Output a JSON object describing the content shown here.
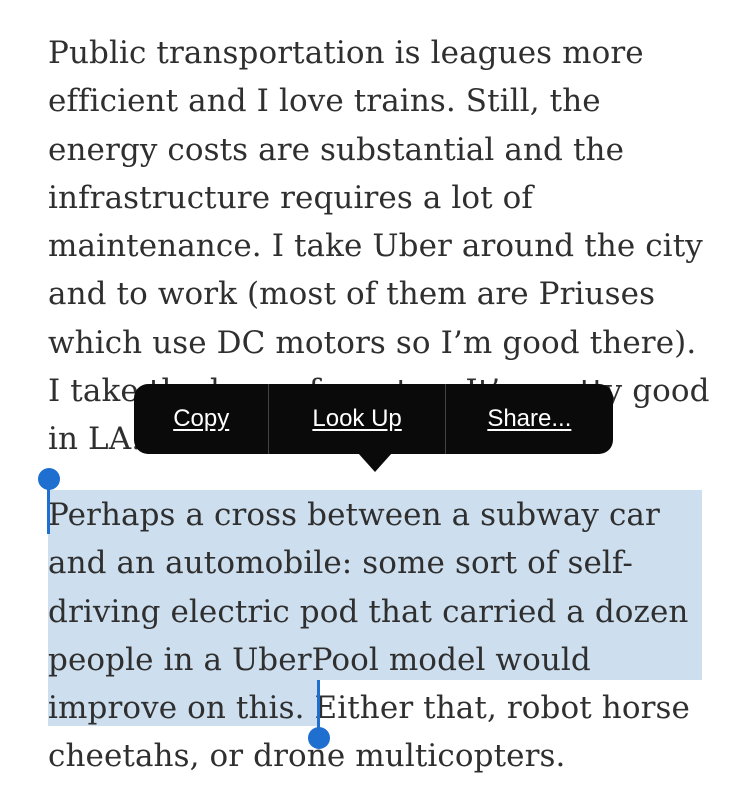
{
  "paragraph1": {
    "lines": [
      "Public transportation is leagues more",
      "efficient and I love trains. Still, the",
      "energy costs are substantial and the",
      "infrastructure requires a lot of",
      "maintenance. I take Uber around the city",
      "and to work (most of them are Priuses",
      "which use DC motors so I’m good there).",
      "I take the horse-ferry too. It’s pretty good",
      "in LA."
    ]
  },
  "paragraph2": {
    "selected_lines": [
      "Perhaps a cross between a subway car",
      "and an automobile: some sort of self-",
      "driving electric pod that carried a dozen",
      "people in a UberPool model would"
    ],
    "last_selected_fragment": "improve on this.",
    "unselected_tail": " Either that, robot horse",
    "final_line": "cheetahs, or drone multicopters."
  },
  "context_menu": {
    "copy_label": "Copy",
    "lookup_label": "Look Up",
    "share_label": "Share..."
  },
  "colors": {
    "selection_highlight": "#cddeee",
    "handle": "#1f6fd1",
    "menu_background": "#0a0a0a",
    "text": "#2f2f2f"
  }
}
